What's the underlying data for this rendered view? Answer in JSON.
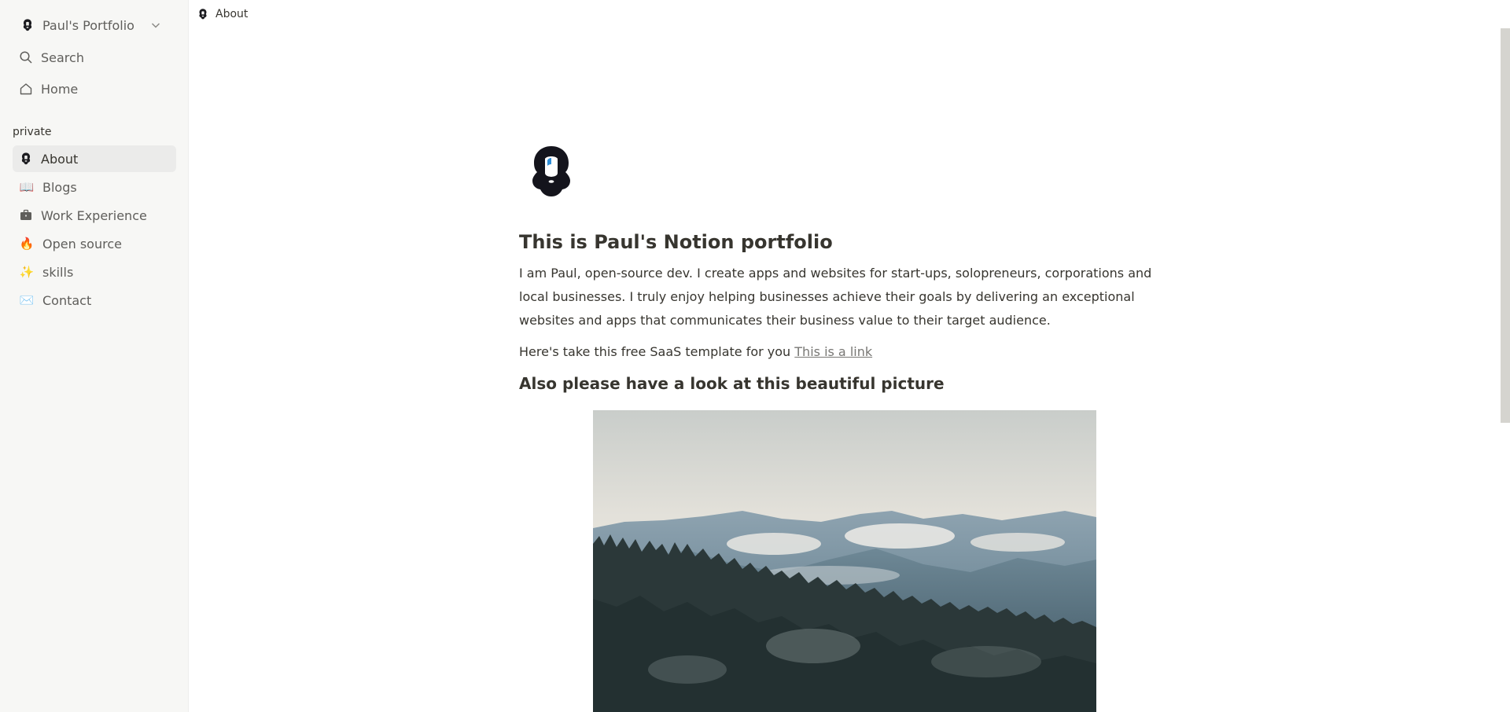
{
  "workspace": {
    "name": "Paul's Portfolio",
    "icon": "avatar-icon"
  },
  "nav": {
    "search_label": "Search",
    "home_label": "Home"
  },
  "sidebar": {
    "section_label": "private",
    "items": [
      {
        "label": "About",
        "icon": "avatar-icon",
        "active": true
      },
      {
        "label": "Blogs",
        "emoji": "📖"
      },
      {
        "label": "Work Experience",
        "icon": "briefcase-icon"
      },
      {
        "label": "Open source",
        "emoji": "🔥"
      },
      {
        "label": "skills",
        "emoji": "✨"
      },
      {
        "label": "Contact",
        "emoji": "✉️"
      }
    ]
  },
  "breadcrumb": {
    "label": "About",
    "icon": "avatar-icon"
  },
  "page": {
    "title": "This is Paul's Notion portfolio",
    "intro": "I am Paul, open-source dev. I create apps and websites for start-ups, solopreneurs, corporations and local businesses. I truly enjoy helping businesses achieve their goals by delivering an exceptional websites and apps that communicates their business value to their target audience.",
    "template_text": "Here's take this free SaaS template for you ",
    "link_text": "This is a link",
    "subheading": "Also please have a look at this beautiful picture"
  },
  "colors": {
    "sidebar_bg": "#f7f7f5",
    "active_item_bg": "#ebebea",
    "text": "#37352f",
    "muted_text": "#5f5e5b",
    "link": "#787774",
    "scrollbar_thumb": "#d5d4cf"
  }
}
